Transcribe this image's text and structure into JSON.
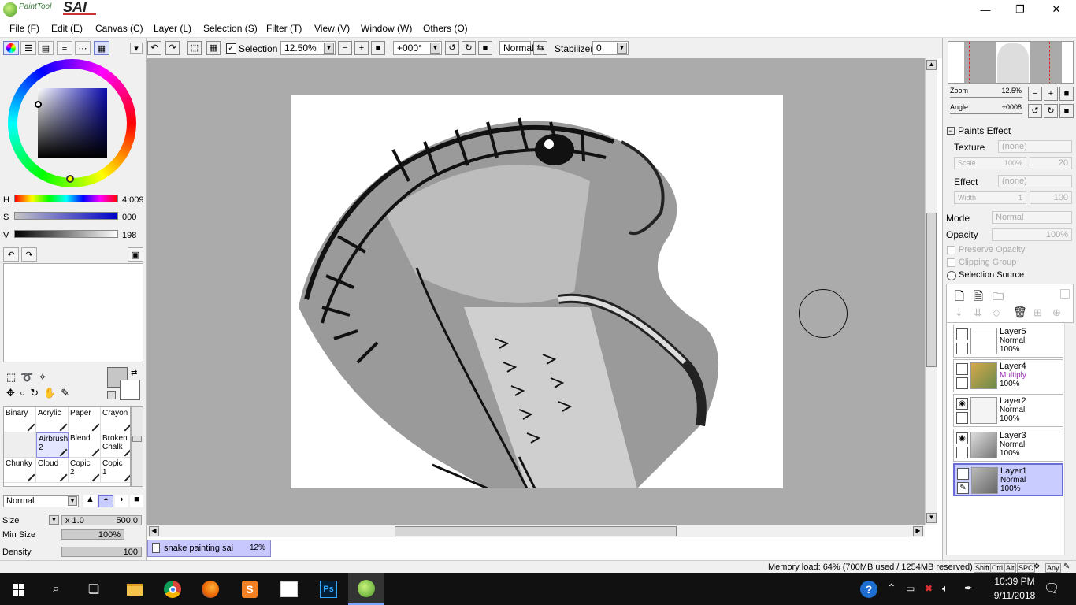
{
  "app": {
    "logo_sub": "PaintTool",
    "logo_main": "SAI"
  },
  "window_controls": {
    "minimize": "—",
    "restore": "❐",
    "close": "✕"
  },
  "menu": [
    "File (F)",
    "Edit (E)",
    "Canvas (C)",
    "Layer (L)",
    "Selection (S)",
    "Filter (T)",
    "View (V)",
    "Window (W)",
    "Others (O)"
  ],
  "toolbar": {
    "selection_label": "Selection",
    "zoom": "12.50%",
    "angle": "+000°",
    "blend_mode": "Normal",
    "stabilizer_label": "Stabilizer",
    "stabilizer_value": "0"
  },
  "color": {
    "h_label": "H",
    "h_value": "4:009",
    "s_label": "S",
    "s_value": "000",
    "v_label": "V",
    "v_value": "198",
    "primary": "#c6c6c6",
    "secondary": "#ffffff",
    "hue_square": "#0a0ab0"
  },
  "brushes": [
    {
      "name": "Binary",
      "sub": ""
    },
    {
      "name": "Acrylic",
      "sub": ""
    },
    {
      "name": "Paper",
      "sub": ""
    },
    {
      "name": "Crayon",
      "sub": ""
    },
    {
      "name": "",
      "sub": ""
    },
    {
      "name": "Airbrush",
      "sub": "2"
    },
    {
      "name": "Blend",
      "sub": ""
    },
    {
      "name": "Broken",
      "sub": "Chalk"
    },
    {
      "name": "Chunky",
      "sub": ""
    },
    {
      "name": "Cloud",
      "sub": ""
    },
    {
      "name": "Copic",
      "sub": "2"
    },
    {
      "name": "Copic",
      "sub": "1"
    }
  ],
  "brush_settings": {
    "mode": "Normal",
    "size_label": "Size",
    "size_multiplier": "x 1.0",
    "size_value": "500.0",
    "minsize_label": "Min Size",
    "minsize_value": "100%",
    "density_label": "Density",
    "density_value": "100"
  },
  "document_tab": {
    "name": "snake painting.sai",
    "zoom": "12%"
  },
  "navigator": {
    "zoom_label": "Zoom",
    "zoom_value": "12.5%",
    "angle_label": "Angle",
    "angle_value": "+0008"
  },
  "paints_effect": {
    "header": "Paints Effect",
    "texture_label": "Texture",
    "texture_value": "(none)",
    "scale_label": "Scale",
    "scale_value": "100%",
    "scale_num": "20",
    "effect_label": "Effect",
    "effect_value": "(none)",
    "width_label": "Width",
    "width_value": "1",
    "width_num": "100"
  },
  "layer_props": {
    "mode_label": "Mode",
    "mode_value": "Normal",
    "opacity_label": "Opacity",
    "opacity_value": "100%",
    "preserve_opacity": "Preserve Opacity",
    "clipping_group": "Clipping Group",
    "selection_source": "Selection Source"
  },
  "layers": [
    {
      "name": "Layer5",
      "mode": "Normal",
      "opacity": "100%",
      "visible": false,
      "selected": false
    },
    {
      "name": "Layer4",
      "mode": "Multiply",
      "opacity": "100%",
      "visible": false,
      "selected": false
    },
    {
      "name": "Layer2",
      "mode": "Normal",
      "opacity": "100%",
      "visible": true,
      "selected": false
    },
    {
      "name": "Layer3",
      "mode": "Normal",
      "opacity": "100%",
      "visible": true,
      "selected": false
    },
    {
      "name": "Layer1",
      "mode": "Normal",
      "opacity": "100%",
      "visible": false,
      "selected": true
    }
  ],
  "status": {
    "memory": "Memory load: 64% (700MB used / 1254MB reserved)",
    "keys": [
      "Shift",
      "Ctrl",
      "Alt",
      "SPC",
      "Any"
    ]
  },
  "taskbar": {
    "time": "10:39 PM",
    "date": "9/11/2018"
  }
}
